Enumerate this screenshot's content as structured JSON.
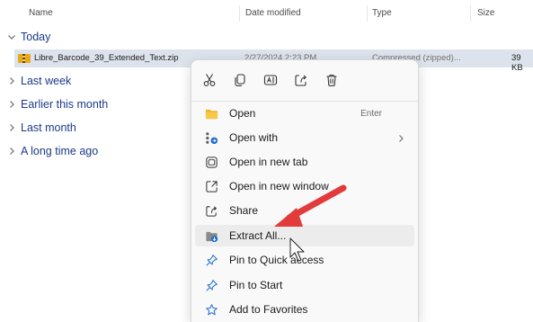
{
  "header": {
    "name": "Name",
    "date_modified": "Date modified",
    "type": "Type",
    "size": "Size"
  },
  "groups": {
    "today": "Today",
    "last_week": "Last week",
    "earlier_this_month": "Earlier this month",
    "last_month": "Last month",
    "long_time_ago": "A long time ago"
  },
  "file": {
    "name": "Libre_Barcode_39_Extended_Text.zip",
    "date": "2/27/2024 2:23 PM",
    "type": "Compressed (zipped)...",
    "size": "39 KB"
  },
  "toolbar": {
    "icons": [
      "cut-icon",
      "copy-icon",
      "rename-icon",
      "share-icon",
      "delete-icon"
    ]
  },
  "menu": {
    "open": "Open",
    "open_accel": "Enter",
    "open_with": "Open with",
    "open_new_tab": "Open in new tab",
    "open_new_window": "Open in new window",
    "share": "Share",
    "extract_all": "Extract All...",
    "pin_quick_access": "Pin to Quick access",
    "pin_start": "Pin to Start",
    "add_favorites": "Add to Favorites"
  },
  "colors": {
    "selection": "#dde3ec",
    "group_text": "#1b3a8a",
    "folder": "#e8a91c",
    "accent_blue": "#1f6fd0",
    "arrow": "#e23b3b"
  }
}
